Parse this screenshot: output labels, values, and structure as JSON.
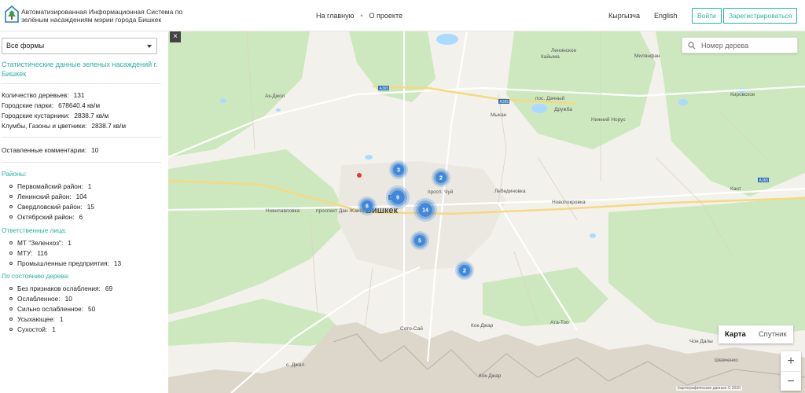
{
  "header": {
    "title": "Автоматизированная Информационная Система по зелёным насаждениям мэрии города Бишкек",
    "nav": [
      "На главную",
      "О проекте"
    ],
    "nav_separator": "•",
    "langs": [
      "Кыргызча",
      "English"
    ],
    "login": "Войти",
    "register": "Зарегистрироваться"
  },
  "sidebar": {
    "select_value": "Все формы",
    "stat_title": "Статистические данные зеленых насаждений г. Бишкек",
    "totals": [
      {
        "label": "Количество деревьев:",
        "value": "131"
      },
      {
        "label": "Городские парки:",
        "value": "678640.4 кв/м"
      },
      {
        "label": "Городские кустарники:",
        "value": "2838.7 кв/м"
      },
      {
        "label": "Клумбы, Газоны и цветники:",
        "value": "2838.7 кв/м"
      }
    ],
    "comments": {
      "label": "Оставленные комментарии:",
      "value": "10"
    },
    "districts_title": "Районы:",
    "districts": [
      {
        "label": "Первомайский район:",
        "value": "1"
      },
      {
        "label": "Ленинский район:",
        "value": "104"
      },
      {
        "label": "Свердловский район:",
        "value": "15"
      },
      {
        "label": "Октябрский район:",
        "value": "6"
      }
    ],
    "responsible_title": "Ответственные лица:",
    "responsible": [
      {
        "label": "МТ \"Зеленхоз\":",
        "value": "1"
      },
      {
        "label": "МТУ:",
        "value": "116"
      },
      {
        "label": "Промышленные предприятия:",
        "value": "13"
      }
    ],
    "condition_title": "По состоянию дерева:",
    "condition": [
      {
        "label": "Без признаков ослабления:",
        "value": "69"
      },
      {
        "label": "Ослабленное:",
        "value": "10"
      },
      {
        "label": "Сильно ослабленное:",
        "value": "50"
      },
      {
        "label": "Усыхающее:",
        "value": "1"
      },
      {
        "label": "Сухостой:",
        "value": "1"
      }
    ]
  },
  "map": {
    "collapse": "×",
    "search_placeholder": "Номер дерева",
    "map_types": [
      "Карта",
      "Спутник"
    ],
    "zoom_in": "+",
    "zoom_out": "−",
    "attribution": "Картографические данные © 2020",
    "clusters": [
      "3",
      "2",
      "9",
      "6",
      "14",
      "5",
      "2"
    ],
    "labels": {
      "city": "Бишкек",
      "places": [
        "Ленинское",
        "Кайыма",
        "Милянфан",
        "Ак-Джол",
        "пос. Дачный",
        "Дружба",
        "Мыкан",
        "Нижний Норус",
        "Кировское",
        "Лебединовка",
        "Новопокровка",
        "Новопавловка",
        "Кант",
        "Сокулук",
        "Сото-Сай",
        "Кок-Джар",
        "Ата-Тоо",
        "Чон Далы",
        "Шевченко",
        "с. Джал",
        "Кок-Джар"
      ],
      "streets": [
        "проспект Дан Жанги",
        "просп. Чуй",
        "Бишкек"
      ],
      "roads": [
        "A365",
        "A365",
        "A365",
        "A365"
      ]
    },
    "colors": {
      "cluster": "#3d86d8",
      "water": "#aadaff",
      "green": "#cfe9c0",
      "road": "#ffffff",
      "highway": "#f6d980"
    }
  }
}
